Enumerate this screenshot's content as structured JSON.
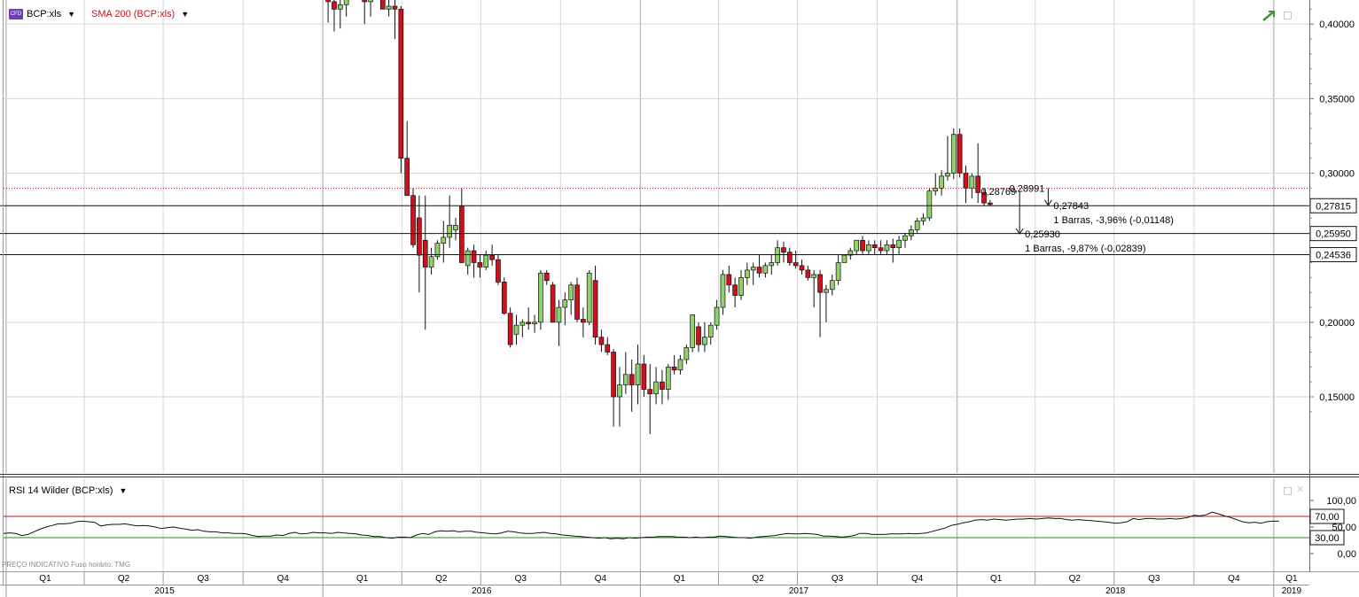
{
  "price_panel": {
    "symbol_label": "BCP:xls",
    "sma_label": "SMA 200 (BCP:xls)",
    "icon": "cfd-icon",
    "hlines": [
      {
        "value": 0.27815,
        "label": "0,27815"
      },
      {
        "value": 0.2595,
        "label": "0,25950"
      },
      {
        "value": 0.24536,
        "label": "0,24536"
      }
    ],
    "dotted_line_value": 0.2898,
    "annotations": {
      "a1_start": "0,28769",
      "a1_end": "0,25930",
      "a1_info": "1 Barras, -9,87% (-0,02839)",
      "a2_start": "0,28991",
      "a2_end": "0,27843",
      "a2_info": "1 Barras, -3,96% (-0,01148)"
    },
    "colors": {
      "up": "#8fd16a",
      "down": "#d0111b",
      "sma": "#c0181b",
      "grid": "#d6d6d6"
    }
  },
  "rsi_panel": {
    "label": "RSI 14 Wilder (BCP:xls)",
    "overbought": {
      "value": 70,
      "label": "70,00",
      "color": "#c0181b"
    },
    "oversold": {
      "value": 30,
      "label": "30,00",
      "color": "#2a8a2a"
    },
    "axis_ticks": [
      {
        "v": 100,
        "label": "100,00"
      },
      {
        "v": 50,
        "label": "50,00"
      },
      {
        "v": 0,
        "label": "0,00"
      }
    ]
  },
  "footer": {
    "note": "PREÇO INDICATIVO    Fuso horário: TMG"
  },
  "time_axis": {
    "quarters": [
      "Q1",
      "Q2",
      "Q3",
      "Q4",
      "Q1",
      "Q2",
      "Q3",
      "Q4",
      "Q1",
      "Q2",
      "Q3",
      "Q4",
      "Q1",
      "Q2",
      "Q3",
      "Q4",
      "Q1"
    ],
    "years": [
      {
        "label": "2015"
      },
      {
        "label": "2016"
      },
      {
        "label": "2017"
      },
      {
        "label": "2018"
      },
      {
        "label": "2019"
      }
    ]
  },
  "chart_data": [
    {
      "type": "candlestick",
      "title": "BCP:xls",
      "series_name": "BCP:xls",
      "x_unit": "week",
      "y_ticks": [
        {
          "v": 0.4,
          "label": "0,40000"
        },
        {
          "v": 0.35,
          "label": "0,35000"
        },
        {
          "v": 0.3,
          "label": "0,30000"
        },
        {
          "v": 0.2,
          "label": "0,20000"
        },
        {
          "v": 0.15,
          "label": "0,15000"
        }
      ],
      "ylim": [
        0.115,
        0.42
      ],
      "x_range": [
        "2014-12-29",
        "2019-02-11"
      ],
      "candles": [
        [
          "2016-01-04",
          0.422,
          0.428,
          0.401,
          0.415
        ],
        [
          "2016-01-11",
          0.415,
          0.42,
          0.395,
          0.41
        ],
        [
          "2016-01-18",
          0.41,
          0.42,
          0.397,
          0.413
        ],
        [
          "2016-01-25",
          0.413,
          0.43,
          0.405,
          0.42
        ],
        [
          "2016-02-15",
          0.425,
          0.43,
          0.4,
          0.415
        ],
        [
          "2016-02-22",
          0.415,
          0.425,
          0.405,
          0.42
        ],
        [
          "2016-03-07",
          0.43,
          0.435,
          0.41,
          0.41
        ],
        [
          "2016-03-14",
          0.41,
          0.418,
          0.405,
          0.412
        ],
        [
          "2016-03-21",
          0.412,
          0.42,
          0.39,
          0.41
        ],
        [
          "2016-03-28",
          0.41,
          0.412,
          0.3,
          0.31
        ],
        [
          "2016-04-04",
          0.31,
          0.335,
          0.285,
          0.285
        ],
        [
          "2016-04-11",
          0.285,
          0.29,
          0.25,
          0.252
        ],
        [
          "2016-04-18",
          0.27,
          0.285,
          0.22,
          0.245
        ],
        [
          "2016-04-25",
          0.255,
          0.285,
          0.195,
          0.237
        ],
        [
          "2016-05-02",
          0.237,
          0.25,
          0.232,
          0.244
        ],
        [
          "2016-05-09",
          0.244,
          0.255,
          0.242,
          0.253
        ],
        [
          "2016-05-16",
          0.253,
          0.268,
          0.24,
          0.257
        ],
        [
          "2016-05-23",
          0.257,
          0.285,
          0.25,
          0.265
        ],
        [
          "2016-05-30",
          0.262,
          0.27,
          0.255,
          0.265
        ],
        [
          "2016-06-06",
          0.278,
          0.29,
          0.24,
          0.24
        ],
        [
          "2016-06-13",
          0.238,
          0.25,
          0.232,
          0.248
        ],
        [
          "2016-06-20",
          0.248,
          0.252,
          0.23,
          0.24
        ],
        [
          "2016-06-27",
          0.24,
          0.245,
          0.23,
          0.237
        ],
        [
          "2016-07-04",
          0.237,
          0.248,
          0.235,
          0.245
        ],
        [
          "2016-07-11",
          0.245,
          0.252,
          0.238,
          0.242
        ],
        [
          "2016-07-18",
          0.242,
          0.245,
          0.225,
          0.227
        ],
        [
          "2016-07-25",
          0.227,
          0.23,
          0.205,
          0.206
        ],
        [
          "2016-08-01",
          0.206,
          0.21,
          0.183,
          0.185
        ],
        [
          "2016-08-08",
          0.192,
          0.205,
          0.185,
          0.198
        ],
        [
          "2016-08-15",
          0.198,
          0.202,
          0.19,
          0.2
        ],
        [
          "2016-08-22",
          0.2,
          0.21,
          0.195,
          0.199
        ],
        [
          "2016-08-29",
          0.199,
          0.205,
          0.193,
          0.2
        ],
        [
          "2016-09-05",
          0.2,
          0.235,
          0.195,
          0.233
        ],
        [
          "2016-09-12",
          0.233,
          0.235,
          0.225,
          0.228
        ],
        [
          "2016-09-19",
          0.225,
          0.227,
          0.2,
          0.2
        ],
        [
          "2016-09-26",
          0.2,
          0.215,
          0.184,
          0.21
        ],
        [
          "2016-10-03",
          0.21,
          0.22,
          0.198,
          0.215
        ],
        [
          "2016-10-10",
          0.215,
          0.227,
          0.205,
          0.225
        ],
        [
          "2016-10-17",
          0.225,
          0.23,
          0.2,
          0.202
        ],
        [
          "2016-10-24",
          0.202,
          0.21,
          0.19,
          0.2
        ],
        [
          "2016-10-31",
          0.2,
          0.235,
          0.198,
          0.233
        ],
        [
          "2016-11-07",
          0.228,
          0.238,
          0.185,
          0.19
        ],
        [
          "2016-11-14",
          0.19,
          0.195,
          0.18,
          0.185
        ],
        [
          "2016-11-21",
          0.185,
          0.19,
          0.178,
          0.18
        ],
        [
          "2016-11-28",
          0.18,
          0.182,
          0.13,
          0.15
        ],
        [
          "2016-12-05",
          0.15,
          0.17,
          0.13,
          0.158
        ],
        [
          "2016-12-12",
          0.158,
          0.18,
          0.152,
          0.165
        ],
        [
          "2016-12-19",
          0.165,
          0.175,
          0.14,
          0.158
        ],
        [
          "2016-12-26",
          0.158,
          0.185,
          0.145,
          0.172
        ],
        [
          "2017-01-02",
          0.172,
          0.178,
          0.15,
          0.155
        ],
        [
          "2017-01-09",
          0.155,
          0.172,
          0.125,
          0.152
        ],
        [
          "2017-01-16",
          0.152,
          0.17,
          0.145,
          0.16
        ],
        [
          "2017-01-23",
          0.16,
          0.168,
          0.145,
          0.155
        ],
        [
          "2017-01-30",
          0.155,
          0.172,
          0.148,
          0.17
        ],
        [
          "2017-02-06",
          0.17,
          0.178,
          0.165,
          0.168
        ],
        [
          "2017-02-13",
          0.168,
          0.178,
          0.165,
          0.175
        ],
        [
          "2017-02-20",
          0.175,
          0.185,
          0.172,
          0.183
        ],
        [
          "2017-02-27",
          0.183,
          0.205,
          0.18,
          0.205
        ],
        [
          "2017-03-06",
          0.197,
          0.2,
          0.18,
          0.185
        ],
        [
          "2017-03-13",
          0.185,
          0.2,
          0.18,
          0.19
        ],
        [
          "2017-03-20",
          0.19,
          0.2,
          0.185,
          0.198
        ],
        [
          "2017-03-27",
          0.198,
          0.215,
          0.195,
          0.21
        ],
        [
          "2017-04-03",
          0.21,
          0.235,
          0.205,
          0.232
        ],
        [
          "2017-04-10",
          0.232,
          0.238,
          0.22,
          0.225
        ],
        [
          "2017-04-17",
          0.225,
          0.23,
          0.21,
          0.218
        ],
        [
          "2017-04-24",
          0.218,
          0.235,
          0.215,
          0.23
        ],
        [
          "2017-05-01",
          0.23,
          0.24,
          0.225,
          0.235
        ],
        [
          "2017-05-08",
          0.235,
          0.24,
          0.225,
          0.237
        ],
        [
          "2017-05-15",
          0.237,
          0.245,
          0.23,
          0.233
        ],
        [
          "2017-05-22",
          0.233,
          0.24,
          0.23,
          0.238
        ],
        [
          "2017-05-29",
          0.238,
          0.245,
          0.232,
          0.24
        ],
        [
          "2017-06-05",
          0.24,
          0.255,
          0.238,
          0.25
        ],
        [
          "2017-06-12",
          0.25,
          0.254,
          0.24,
          0.247
        ],
        [
          "2017-06-19",
          0.247,
          0.25,
          0.238,
          0.24
        ],
        [
          "2017-06-26",
          0.24,
          0.248,
          0.236,
          0.238
        ],
        [
          "2017-07-03",
          0.238,
          0.242,
          0.232,
          0.235
        ],
        [
          "2017-07-10",
          0.235,
          0.238,
          0.228,
          0.23
        ],
        [
          "2017-07-17",
          0.23,
          0.235,
          0.21,
          0.232
        ],
        [
          "2017-07-24",
          0.232,
          0.235,
          0.19,
          0.22
        ],
        [
          "2017-07-31",
          0.22,
          0.225,
          0.2,
          0.222
        ],
        [
          "2017-08-07",
          0.222,
          0.232,
          0.218,
          0.228
        ],
        [
          "2017-08-14",
          0.228,
          0.245,
          0.225,
          0.24
        ],
        [
          "2017-08-21",
          0.24,
          0.245,
          0.24,
          0.245
        ],
        [
          "2017-08-28",
          0.245,
          0.25,
          0.242,
          0.248
        ],
        [
          "2017-09-04",
          0.248,
          0.255,
          0.245,
          0.255
        ],
        [
          "2017-09-11",
          0.255,
          0.258,
          0.245,
          0.248
        ],
        [
          "2017-09-18",
          0.248,
          0.255,
          0.245,
          0.252
        ],
        [
          "2017-09-25",
          0.252,
          0.255,
          0.245,
          0.25
        ],
        [
          "2017-10-02",
          0.25,
          0.255,
          0.245,
          0.248
        ],
        [
          "2017-10-09",
          0.248,
          0.255,
          0.245,
          0.252
        ],
        [
          "2017-10-16",
          0.252,
          0.256,
          0.24,
          0.25
        ],
        [
          "2017-10-23",
          0.25,
          0.258,
          0.245,
          0.255
        ],
        [
          "2017-10-30",
          0.255,
          0.26,
          0.25,
          0.258
        ],
        [
          "2017-11-06",
          0.258,
          0.265,
          0.255,
          0.262
        ],
        [
          "2017-11-13",
          0.262,
          0.27,
          0.26,
          0.268
        ],
        [
          "2017-11-20",
          0.268,
          0.273,
          0.265,
          0.27
        ],
        [
          "2017-11-27",
          0.27,
          0.29,
          0.268,
          0.288
        ],
        [
          "2017-12-04",
          0.288,
          0.3,
          0.285,
          0.29
        ],
        [
          "2017-12-11",
          0.29,
          0.302,
          0.285,
          0.298
        ],
        [
          "2017-12-18",
          0.298,
          0.325,
          0.295,
          0.3
        ],
        [
          "2017-12-25",
          0.3,
          0.33,
          0.296,
          0.326
        ],
        [
          "2018-01-01",
          0.326,
          0.33,
          0.297,
          0.3
        ],
        [
          "2018-01-08",
          0.3,
          0.305,
          0.28,
          0.29
        ],
        [
          "2018-01-15",
          0.29,
          0.3,
          0.283,
          0.298
        ],
        [
          "2018-01-22",
          0.298,
          0.32,
          0.28,
          0.287
        ],
        [
          "2018-01-29",
          0.287,
          0.29,
          0.278,
          0.28
        ],
        [
          "2018-02-05",
          0.28,
          0.282,
          0.278,
          0.279
        ]
      ]
    },
    {
      "type": "line",
      "title": "RSI 14 Wilder (BCP:xls)",
      "series_name": "RSI 14 Wilder (BCP:xls)",
      "x_unit": "week",
      "ylim": [
        0,
        100
      ],
      "x_range": [
        "2014-12-29",
        "2019-02-11"
      ],
      "x_start": "2014-12-29",
      "x_step_days": 7,
      "values": [
        38,
        39,
        38,
        34,
        36,
        41,
        46,
        50,
        53,
        56,
        56,
        57,
        60,
        61,
        60,
        59,
        52,
        54,
        55,
        55,
        56,
        54,
        52,
        53,
        52,
        50,
        47,
        49,
        50,
        48,
        46,
        44,
        45,
        42,
        41,
        41,
        39,
        39,
        38,
        38,
        37,
        34,
        32,
        33,
        33,
        35,
        34,
        38,
        40,
        37,
        38,
        40,
        39,
        39,
        38,
        40,
        39,
        38,
        37,
        35,
        34,
        32,
        32,
        30,
        29,
        31,
        31,
        30,
        35,
        38,
        36,
        41,
        43,
        42,
        43,
        41,
        42,
        42,
        40,
        39,
        38,
        37,
        39,
        42,
        41,
        39,
        38,
        38,
        39,
        40,
        38,
        37,
        35,
        34,
        33,
        32,
        31,
        30,
        29,
        30,
        28,
        29,
        28,
        30,
        29,
        30,
        31,
        31,
        32,
        32,
        32,
        31,
        31,
        30,
        31,
        30,
        31,
        31,
        33,
        32,
        31,
        30,
        30,
        29,
        31,
        32,
        33,
        34,
        36,
        38,
        37,
        37,
        38,
        37,
        36,
        33,
        33,
        32,
        31,
        32,
        34,
        38,
        38,
        36,
        36,
        36,
        37,
        37,
        37,
        38,
        37,
        38,
        39,
        42,
        45,
        48,
        53,
        55,
        58,
        60,
        63,
        64,
        63,
        65,
        64,
        63,
        64,
        65,
        65,
        66,
        65,
        66,
        67,
        66,
        66,
        64,
        63,
        64,
        63,
        62,
        61,
        60,
        59,
        57,
        58,
        60,
        66,
        64,
        66,
        66,
        65,
        65,
        66,
        65,
        66,
        68,
        72,
        71,
        73,
        78,
        75,
        71,
        68,
        64,
        60,
        58,
        59,
        57,
        60,
        61,
        61
      ]
    }
  ]
}
